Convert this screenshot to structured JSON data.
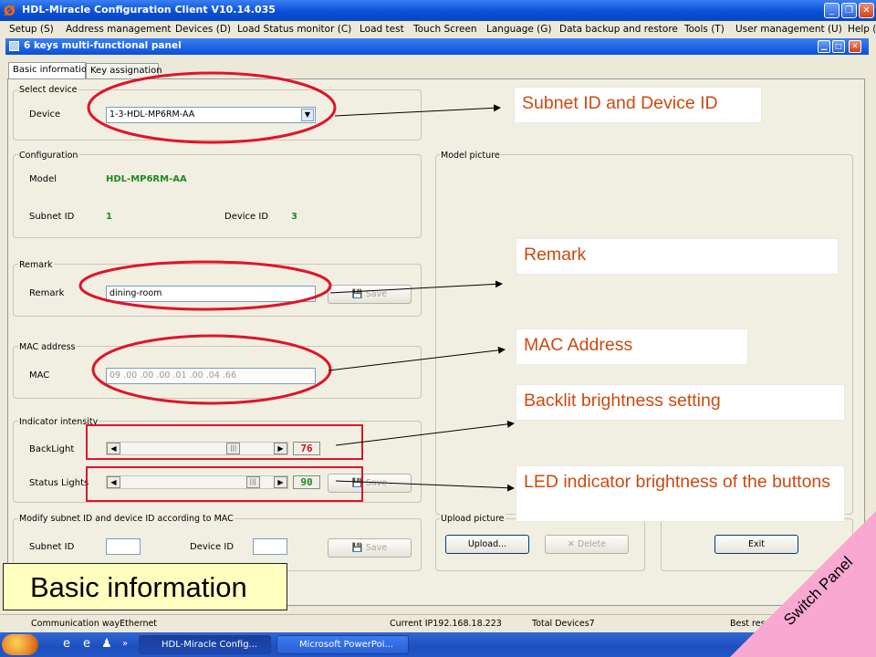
{
  "app": {
    "title": "HDL-Miracle Configuration Client V10.14.035",
    "child_title": "6 keys multi-functional panel"
  },
  "menu": [
    "Setup (S)",
    "Address management",
    "Devices (D)",
    "Load Status monitor (C)",
    "Load test",
    "Touch Screen",
    "Language (G)",
    "Data backup and restore",
    "Tools (T)",
    "User management (U)",
    "Help (H)"
  ],
  "tabs": [
    "Basic information",
    "Key assignation"
  ],
  "select_device": {
    "legend": "Select device",
    "label": "Device",
    "value": "1-3-HDL-MP6RM-AA"
  },
  "configuration": {
    "legend": "Configuration",
    "model_label": "Model",
    "model_value": "HDL-MP6RM-AA",
    "subnet_label": "Subnet ID",
    "subnet_value": "1",
    "device_label": "Device ID",
    "device_value": "3"
  },
  "model_picture": {
    "legend": "Model picture"
  },
  "remark": {
    "legend": "Remark",
    "label": "Remark",
    "value": "dining-room",
    "save": "Save"
  },
  "mac": {
    "legend": "MAC address",
    "label": "MAC",
    "value": "09 .00 .00 .00 .01 .00 .04 .66"
  },
  "indicator": {
    "legend": "Indicator intensity",
    "backlight_label": "BackLight",
    "backlight_value": "76",
    "status_label": "Status Lights",
    "status_value": "90",
    "save": "Save"
  },
  "modify": {
    "legend": "Modify subnet ID and device ID according to MAC",
    "subnet_label": "Subnet ID",
    "device_label": "Device ID",
    "save": "Save"
  },
  "upload": {
    "legend": "Upload picture",
    "upload_btn": "Upload...",
    "delete_btn": "Delete"
  },
  "exit_btn": "Exit",
  "callouts": {
    "subnet_device": "Subnet ID and Device ID",
    "remark": "Remark",
    "mac": "MAC Address",
    "backlit": "Backlit brightness setting",
    "led": "LED indicator brightness of the buttons",
    "basic_info": "Basic information",
    "switch_panel": "Switch Panel"
  },
  "status": {
    "comm": "Communication wayEthernet",
    "ip": "Current IP192.168.18.223",
    "total": "Total Devices7",
    "best": "Best resolu"
  },
  "taskbar": {
    "task1": "HDL-Miracle Config...",
    "task2": "Microsoft PowerPoi..."
  },
  "colors": {
    "callout_text": "#cc4a10",
    "ellipse": "#e0142a",
    "highlight_box": "#e0142a",
    "pink_corner": "#f9a8d2",
    "value_green": "#1e8a1e",
    "value_red": "#d2141e"
  }
}
